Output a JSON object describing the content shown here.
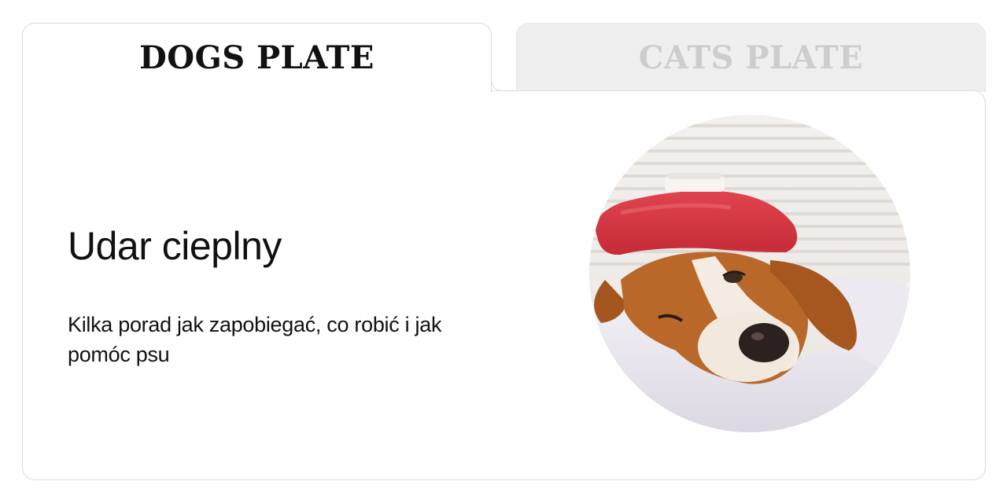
{
  "tabs": {
    "dogs_label": "DOGS PLATE",
    "cats_label": "CATS PLATE"
  },
  "article": {
    "title": "Udar cieplny",
    "description": "Kilka porad jak zapobiegać, co robić i jak pomóc psu"
  },
  "colors": {
    "active_tab_text": "#111111",
    "inactive_tab_text": "#cdcdcd",
    "inactive_tab_background": "#efefef",
    "border": "#d9d9d9"
  },
  "image": {
    "subject": "dog-icepack-photo"
  }
}
